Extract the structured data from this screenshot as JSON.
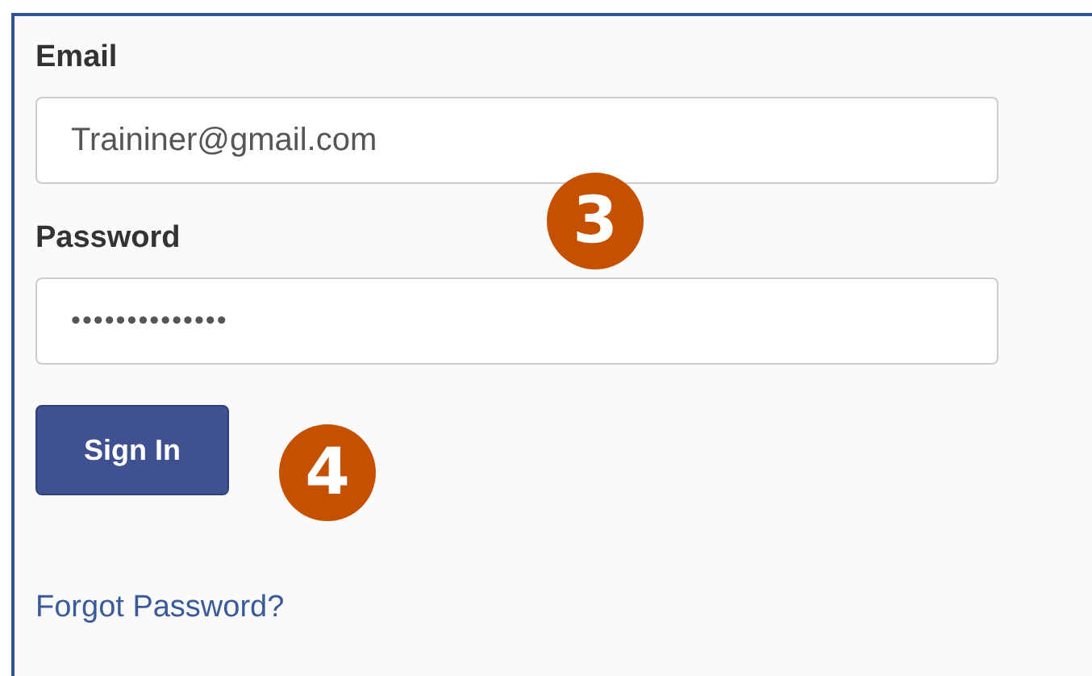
{
  "fields": [
    {
      "label": "Email",
      "kind": "text",
      "value": "Traininer@gmail.com"
    },
    {
      "label": "Password",
      "kind": "password",
      "value": "••••••••••••••"
    }
  ],
  "sign_in_button": "Sign In",
  "callouts": [
    {
      "number": "3"
    },
    {
      "number": "4"
    }
  ],
  "forgot_link": "Forgot Password?"
}
